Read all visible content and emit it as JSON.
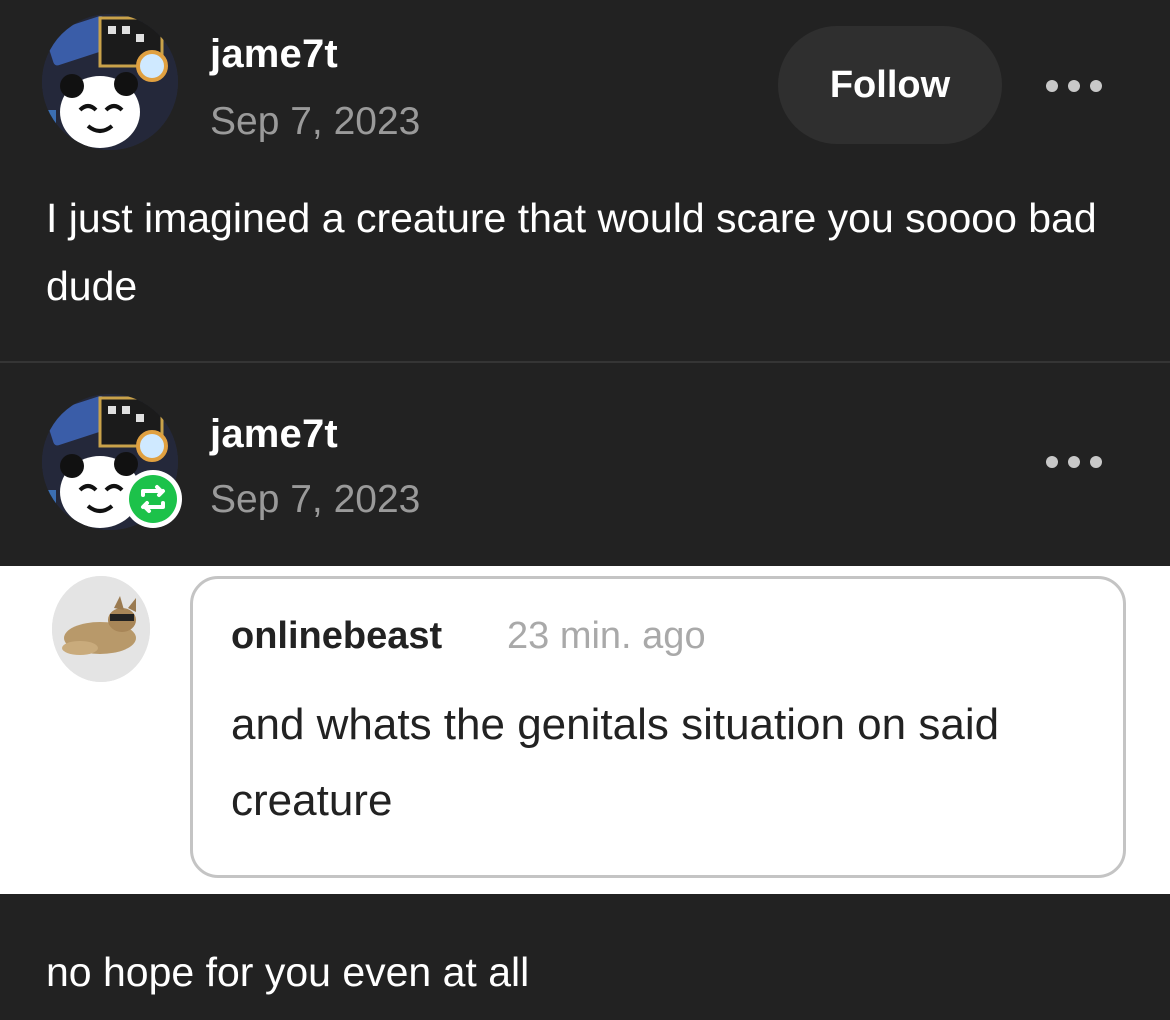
{
  "post": {
    "username": "jame7t",
    "date": "Sep 7, 2023",
    "follow_label": "Follow",
    "text": "I just imagined a creature that would scare you soooo bad dude"
  },
  "reblog": {
    "username": "jame7t",
    "date": "Sep 7, 2023",
    "ask": {
      "username": "onlinebeast",
      "time": "23 min. ago",
      "text": "and whats the genitals situation on said creature"
    },
    "reply": "no hope for you even at all"
  },
  "colors": {
    "background": "#222222",
    "reblog_badge": "#1cc24a",
    "muted_text": "#9a9a9a"
  },
  "icons": [
    "more-options-icon",
    "reblog-icon"
  ]
}
